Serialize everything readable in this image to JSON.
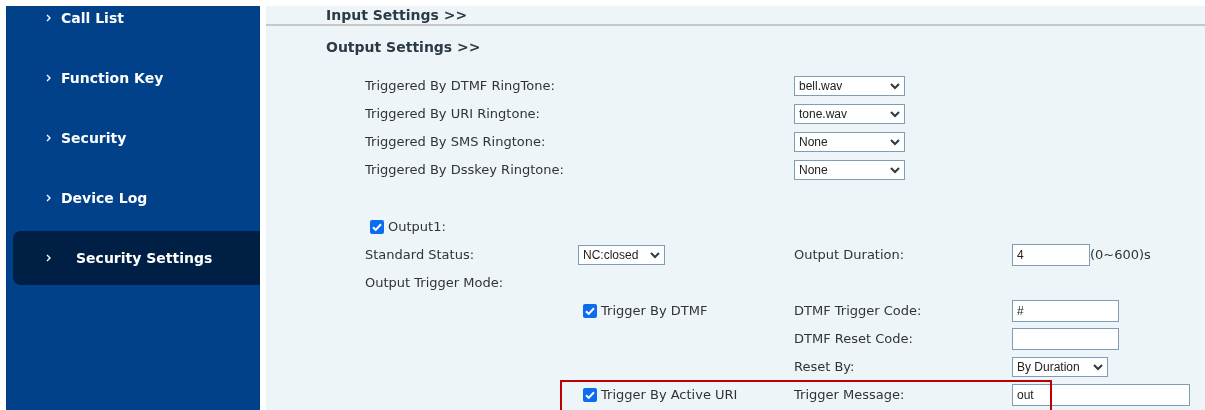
{
  "sidebar": {
    "items": [
      {
        "label": "Call List",
        "selected": false
      },
      {
        "label": "Function Key",
        "selected": false
      },
      {
        "label": "Security",
        "selected": false
      },
      {
        "label": "Device Log",
        "selected": false
      },
      {
        "label": "Security Settings",
        "selected": true
      }
    ]
  },
  "input_settings": {
    "heading": "Input Settings >>"
  },
  "output_settings": {
    "heading": "Output Settings >>",
    "ringtones": [
      {
        "label": "Triggered By DTMF RingTone:",
        "value": "bell.wav"
      },
      {
        "label": "Triggered By URI Ringtone:",
        "value": "tone.wav"
      },
      {
        "label": "Triggered By SMS Ringtone:",
        "value": "None"
      },
      {
        "label": "Triggered By Dsskey Ringtone:",
        "value": "None"
      }
    ],
    "output1": {
      "label": "Output1:",
      "checked": true
    },
    "standard_status": {
      "label": "Standard Status:",
      "value": "NC:closed"
    },
    "output_duration": {
      "label": "Output Duration:",
      "value": "4",
      "range": "(0~600)s"
    },
    "trigger_mode": {
      "label": "Output Trigger Mode:"
    },
    "triggers": [
      {
        "label": "Trigger By DTMF",
        "checked": true,
        "fields": [
          {
            "label": "DTMF Trigger Code:",
            "kind": "input",
            "value": "#"
          },
          {
            "label": "DTMF Reset Code:",
            "kind": "input"
          },
          {
            "label": "Reset By:",
            "kind": "select",
            "value": "By Duration"
          }
        ]
      },
      {
        "label": "Trigger By Active URI",
        "checked": true,
        "fields": [
          {
            "label": "Trigger Message:",
            "kind": "input",
            "value": "out"
          }
        ]
      }
    ]
  }
}
